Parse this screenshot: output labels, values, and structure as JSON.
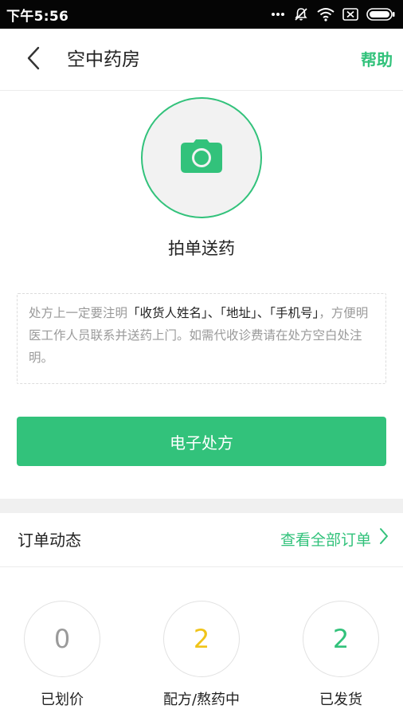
{
  "status_bar": {
    "time": "下午5:56",
    "icons": [
      "more-dots-icon",
      "mute-icon",
      "wifi-icon",
      "sim-off-icon",
      "battery-icon"
    ]
  },
  "nav": {
    "title": "空中药房",
    "help": "帮助"
  },
  "photo": {
    "label": "拍单送药"
  },
  "notice": {
    "part1": "处方上一定要注明",
    "highlight1": "「收货人姓名」、「地址」、「手机号」",
    "part2": "，方便明医工作人员联系并送药上门。如需代收诊费请在处方空白处注明。"
  },
  "rx_button": {
    "label": "电子处方"
  },
  "orders": {
    "title": "订单动态",
    "view_all": "查看全部订单",
    "stats": [
      {
        "value": "0",
        "label": "已划价",
        "color": "#9a9a9a"
      },
      {
        "value": "2",
        "label": "配方/熬药中",
        "color": "#f0c419"
      },
      {
        "value": "2",
        "label": "已发货",
        "color": "#32c27b"
      }
    ]
  },
  "colors": {
    "accent": "#32c27b",
    "status_bar": "#050505",
    "section_gap": "#f0f0f0"
  }
}
